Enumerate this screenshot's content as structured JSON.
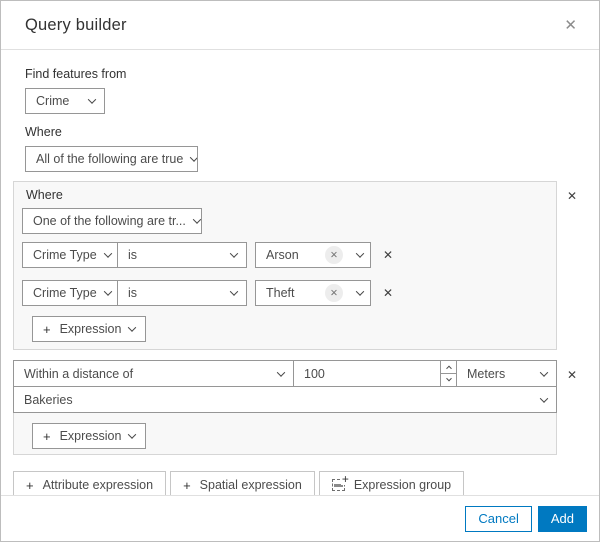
{
  "dialog": {
    "title": "Query builder"
  },
  "icons": {
    "close": "✕",
    "remove": "✕",
    "chip_remove": "✕",
    "plus": "+"
  },
  "find_features": {
    "label": "Find features from",
    "value": "Crime"
  },
  "where_clause": {
    "label": "Where",
    "value": "All of the following are true"
  },
  "group1": {
    "label": "Where",
    "operator_value": "One of the following are tr...",
    "rows": [
      {
        "field": "Crime Type",
        "operator": "is",
        "value": "Arson"
      },
      {
        "field": "Crime Type",
        "operator": "is",
        "value": "Theft"
      }
    ],
    "add_expression_label": "Expression"
  },
  "group2": {
    "operator_value": "Within a distance of",
    "distance_value": "100",
    "unit_value": "Meters",
    "layer_value": "Bakeries",
    "add_expression_label": "Expression"
  },
  "actions": {
    "attribute_expression_label": "Attribute expression",
    "spatial_expression_label": "Spatial expression",
    "expression_group_label": "Expression group"
  },
  "footer": {
    "cancel_label": "Cancel",
    "add_label": "Add"
  },
  "colors": {
    "accent": "#0079c1",
    "text": "#323232",
    "group_bg": "#f8f8f8"
  }
}
